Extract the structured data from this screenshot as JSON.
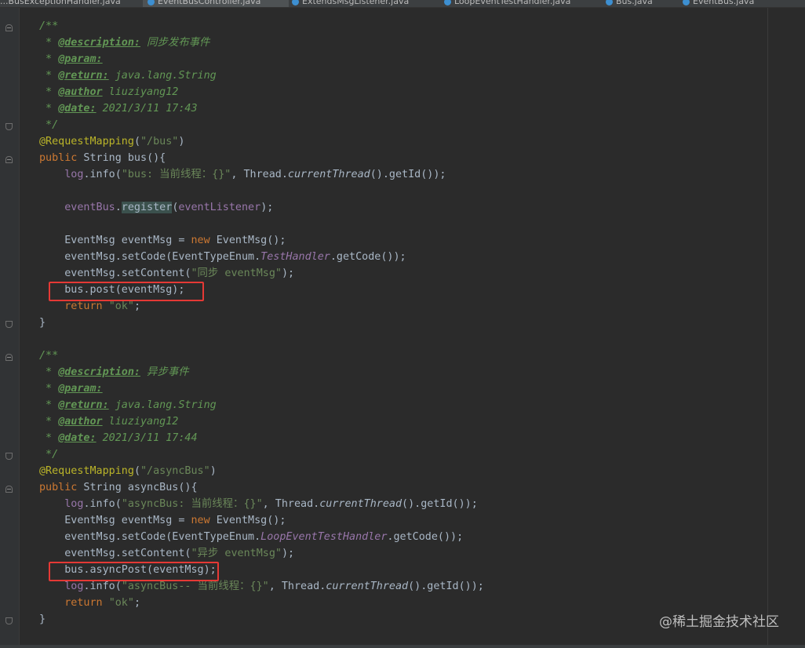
{
  "tabs": [
    {
      "label": "...BusExceptionHandler.java",
      "active": false
    },
    {
      "label": "EventBusController.java",
      "active": true
    },
    {
      "label": "ExtendsMsgListener.java",
      "active": false
    },
    {
      "label": "LoopEventTestHandler.java",
      "active": false
    },
    {
      "label": "Bus.java",
      "active": false
    },
    {
      "label": "EventBus.java",
      "active": false
    }
  ],
  "code": {
    "sync": {
      "doc_open": "/**",
      "description_tag": "@description:",
      "description_text": " 同步发布事件",
      "param_tag": "@param:",
      "return_tag": "@return:",
      "return_text": " java.lang.String",
      "author_tag": "@author",
      "author_text": " liuziyang12",
      "date_tag": "@date:",
      "date_text": " 2021/3/11 17:43",
      "doc_close": " */",
      "annotation": "@RequestMapping",
      "mapping": "\"/bus\"",
      "method_name": "bus",
      "log_str": "\"bus: 当前线程：{}\"",
      "register_call": "register",
      "register_arg": "eventListener",
      "enum_const": "TestHandler",
      "content_str": "\"同步 eventMsg\"",
      "post_line": "bus.post(eventMsg);",
      "ok_str": "\"ok\""
    },
    "async": {
      "doc_open": "/**",
      "description_tag": "@description:",
      "description_text": " 异步事件",
      "param_tag": "@param:",
      "return_tag": "@return:",
      "return_text": " java.lang.String",
      "author_tag": "@author",
      "author_text": " liuziyang12",
      "date_tag": "@date:",
      "date_text": " 2021/3/11 17:44",
      "doc_close": " */",
      "annotation": "@RequestMapping",
      "mapping": "\"/asyncBus\"",
      "method_name": "asyncBus",
      "log_str": "\"asyncBus: 当前线程：{}\"",
      "enum_const": "LoopEventTestHandler",
      "content_str": "\"异步 eventMsg\"",
      "post_line": "bus.asyncPost(eventMsg);",
      "log2_str": "\"asyncBus-- 当前线程：{}\"",
      "ok_str": "\"ok\""
    }
  },
  "watermark": "@稀土掘金技术社区",
  "colors": {
    "background": "#2b2b2b",
    "keyword": "#cc7832",
    "string": "#6a8759",
    "comment": "#629755",
    "annotation": "#bbb529",
    "field": "#9876aa",
    "highlight_box": "#e53935"
  }
}
